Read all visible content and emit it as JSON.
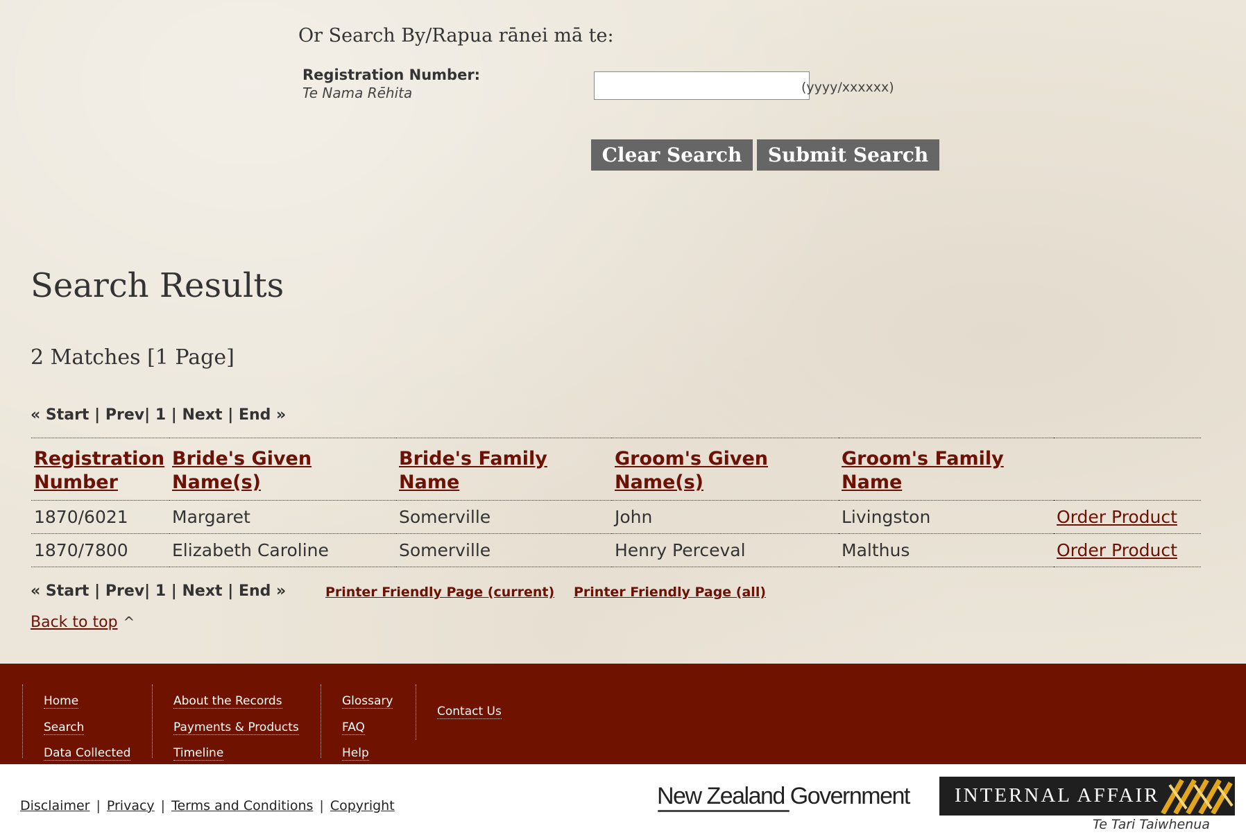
{
  "search": {
    "or_search_by": "Or Search By/Rapua rānei mā te:",
    "registration_label": "Registration Number:",
    "registration_label_maori": "Te Nama Rēhita",
    "registration_value": "",
    "registration_hint": "(yyyy/xxxxxx)",
    "clear_label": "Clear Search",
    "submit_label": "Submit Search"
  },
  "results": {
    "title": "Search Results",
    "matches": "2 Matches [1 Page]",
    "pager": {
      "start": "« Start",
      "prev": "Prev",
      "page": "1",
      "next": "Next",
      "end": "End »",
      "sep": "|"
    },
    "printer_current": "Printer Friendly Page (current)",
    "printer_all": "Printer Friendly Page (all)",
    "columns": [
      "Registration Number",
      "Bride's Given Name(s)",
      "Bride's Family Name",
      "Groom's Given Name(s)",
      "Groom's Family Name"
    ],
    "rows": [
      {
        "registration": "1870/6021",
        "bride_given": "Margaret",
        "bride_family": "Somerville",
        "groom_given": "John",
        "groom_family": "Livingston",
        "action": "Order Product"
      },
      {
        "registration": "1870/7800",
        "bride_given": "Elizabeth Caroline",
        "bride_family": "Somerville",
        "groom_given": "Henry Perceval",
        "groom_family": "Malthus",
        "action": "Order Product"
      }
    ],
    "back_to_top": "Back to top",
    "back_to_top_icon": "^"
  },
  "footer": {
    "col1": [
      "Home",
      "Search",
      "Data Collected"
    ],
    "col2": [
      "About the Records",
      "Payments & Products",
      "Timeline"
    ],
    "col3": [
      "Glossary",
      "FAQ",
      "Help"
    ],
    "col4": [
      "Contact Us"
    ]
  },
  "legal": [
    "Disclaimer",
    "Privacy",
    "Terms and Conditions",
    "Copyright"
  ],
  "branding": {
    "nzgov": "New Zealand Government",
    "ia_title": "Internal Affairs",
    "ia_subtitle": "Te Tari Taiwhenua"
  },
  "colors": {
    "page_bg": "#ece6da",
    "accent": "#701200",
    "link": "#6b1105",
    "button": "#666666"
  }
}
